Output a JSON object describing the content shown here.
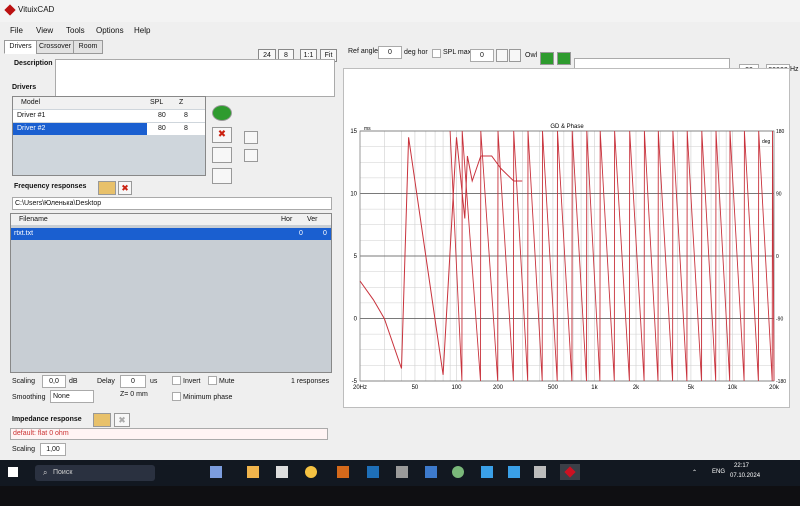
{
  "app": {
    "title": "VituixCAD"
  },
  "menu": [
    "File",
    "View",
    "Tools",
    "Options",
    "Help"
  ],
  "tabs": [
    "Drivers",
    "Crossover",
    "Room"
  ],
  "toolbar": {
    "buttons": [
      "24",
      "8",
      "1:1",
      "Fit"
    ],
    "ref_angle_label": "Ref angle",
    "ref_angle_value": "0",
    "deg_hor_label": "deg hor",
    "spl_max_label": "SPL max",
    "spl_max_value": "0",
    "owl_label": "Owl",
    "freq_min": "20",
    "freq_max": "20000",
    "hz_label": "Hz"
  },
  "description": {
    "label": "Description",
    "value": ""
  },
  "drivers": {
    "title": "Drivers",
    "columns": [
      "Model",
      "SPL",
      "Z"
    ],
    "rows": [
      {
        "model": "Driver #1",
        "spl": "80",
        "z": "8"
      },
      {
        "model": "Driver #2",
        "spl": "80",
        "z": "8"
      }
    ]
  },
  "freq_responses": {
    "title": "Frequency responses",
    "path": "C:\\Users\\Юленька\\Desktop",
    "columns": [
      "Filename",
      "Hor",
      "Ver"
    ],
    "rows": [
      {
        "filename": "rtxt.txt",
        "hor": "0",
        "ver": "0"
      }
    ]
  },
  "controls": {
    "scaling_label": "Scaling",
    "scaling_value": "0,0",
    "db_label": "dB",
    "delay_label": "Delay",
    "delay_value": "0",
    "us_label": "us",
    "invert_label": "Invert",
    "mute_label": "Mute",
    "responses_count": "1 responses",
    "smoothing_label": "Smoothing",
    "smoothing_value": "None",
    "z_label": "Z= 0 mm",
    "min_phase_label": "Minimum phase"
  },
  "impedance": {
    "title": "Impedance response",
    "value": "default: flat 0 ohm",
    "scaling_label": "Scaling",
    "scaling_value": "1,00"
  },
  "graph": {
    "title": "GD & Phase",
    "y_unit": "ms",
    "y_right_unit": "deg",
    "y_ticks": [
      "15",
      "10",
      "5",
      "0",
      "-5"
    ],
    "y_right_ticks": [
      "180",
      "90",
      "0",
      "-90",
      "-180"
    ],
    "x_ticks": [
      "20Hz",
      "50",
      "100",
      "200",
      "500",
      "1k",
      "2k",
      "5k",
      "10k",
      "20k"
    ]
  },
  "chart_data": {
    "type": "line",
    "title": "GD & Phase",
    "x_scale": "log",
    "xlim": [
      20,
      20000
    ],
    "ylim": [
      -5,
      15
    ],
    "y2lim": [
      -180,
      180
    ],
    "grid": true,
    "legend": "none",
    "series": [
      {
        "axis": "y",
        "points": [
          [
            20,
            3
          ],
          [
            25,
            1.5
          ],
          [
            30,
            0
          ],
          [
            40,
            -4
          ],
          [
            45,
            14.5
          ],
          [
            60,
            5
          ],
          [
            80,
            -4.5
          ],
          [
            100,
            14.5
          ],
          [
            115,
            8
          ],
          [
            120,
            13
          ],
          [
            130,
            11
          ],
          [
            150,
            13
          ],
          [
            180,
            13
          ],
          [
            210,
            12
          ],
          [
            260,
            11
          ],
          [
            300,
            11
          ]
        ],
        "color": "#c8323c"
      },
      {
        "axis": "y2",
        "sawtooth_x": [
          90,
          110,
          150,
          200,
          260,
          330,
          420,
          540,
          690,
          880,
          1100,
          1400,
          1800,
          2300,
          2900,
          3700,
          4700,
          6000,
          7600,
          9600,
          12200,
          15500,
          19500
        ],
        "color": "#c8323c"
      }
    ]
  },
  "taskbar": {
    "search_placeholder": "Поиск",
    "time": "22:17",
    "date": "07.10.2024",
    "lang": "ENG"
  },
  "colors": {
    "selection": "#1a5fd0",
    "curve": "#c8323c",
    "grid": "#cfcfcf"
  }
}
